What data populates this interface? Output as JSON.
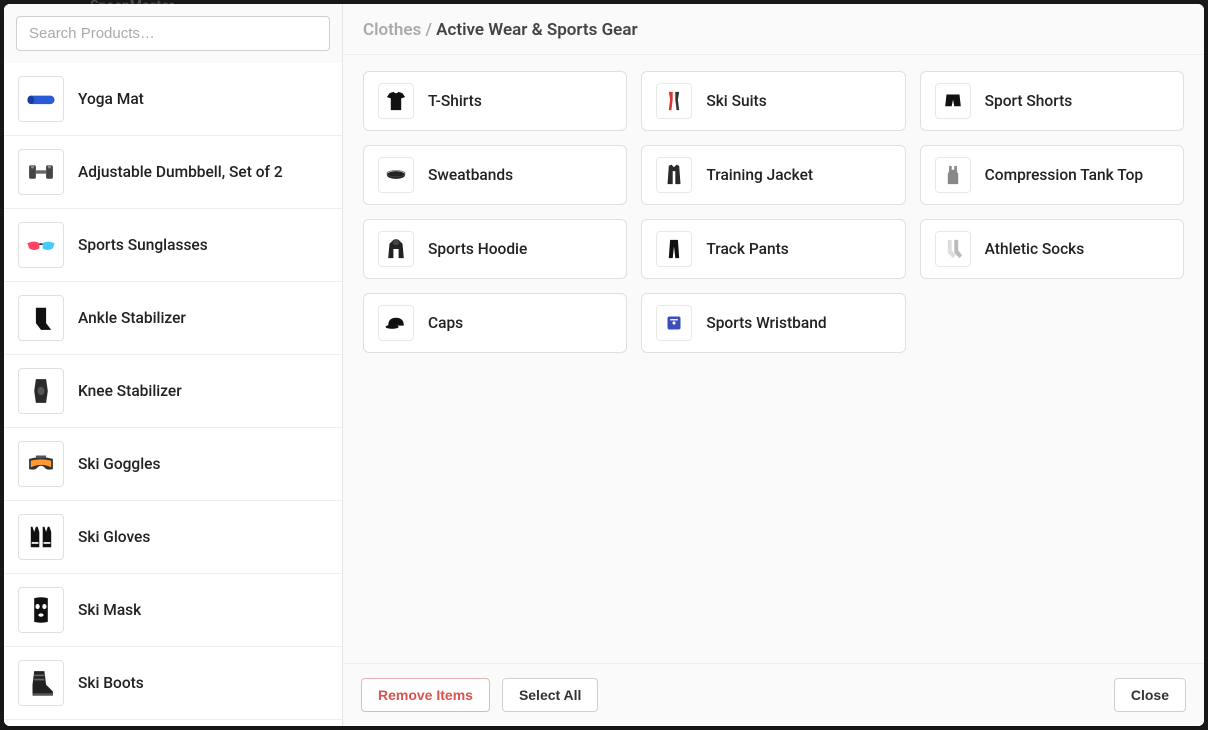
{
  "backdrop_hint": "SpoenMaster",
  "search": {
    "placeholder": "Search Products…"
  },
  "sidebar": {
    "items": [
      {
        "label": "Yoga Mat",
        "icon": "yoga-mat"
      },
      {
        "label": "Adjustable Dumbbell, Set of 2",
        "icon": "dumbbell"
      },
      {
        "label": "Sports Sunglasses",
        "icon": "sunglasses"
      },
      {
        "label": "Ankle Stabilizer",
        "icon": "ankle-brace"
      },
      {
        "label": "Knee Stabilizer",
        "icon": "knee-brace"
      },
      {
        "label": "Ski Goggles",
        "icon": "ski-goggles"
      },
      {
        "label": "Ski Gloves",
        "icon": "ski-gloves"
      },
      {
        "label": "Ski Mask",
        "icon": "ski-mask"
      },
      {
        "label": "Ski Boots",
        "icon": "ski-boots"
      }
    ]
  },
  "breadcrumb": {
    "parent": "Clothes / ",
    "current": "Active Wear & Sports Gear"
  },
  "grid": {
    "items": [
      {
        "label": "T-Shirts",
        "icon": "tshirt"
      },
      {
        "label": "Ski Suits",
        "icon": "ski-suit"
      },
      {
        "label": "Sport Shorts",
        "icon": "shorts"
      },
      {
        "label": "Sweatbands",
        "icon": "sweatband"
      },
      {
        "label": "Training Jacket",
        "icon": "jacket"
      },
      {
        "label": "Compression Tank Top",
        "icon": "tank-top"
      },
      {
        "label": "Sports Hoodie",
        "icon": "hoodie"
      },
      {
        "label": "Track Pants",
        "icon": "track-pants"
      },
      {
        "label": "Athletic Socks",
        "icon": "socks"
      },
      {
        "label": "Caps",
        "icon": "cap"
      },
      {
        "label": "Sports Wristband",
        "icon": "wristband"
      }
    ]
  },
  "footer": {
    "remove": "Remove Items",
    "select_all": "Select All",
    "close": "Close"
  }
}
